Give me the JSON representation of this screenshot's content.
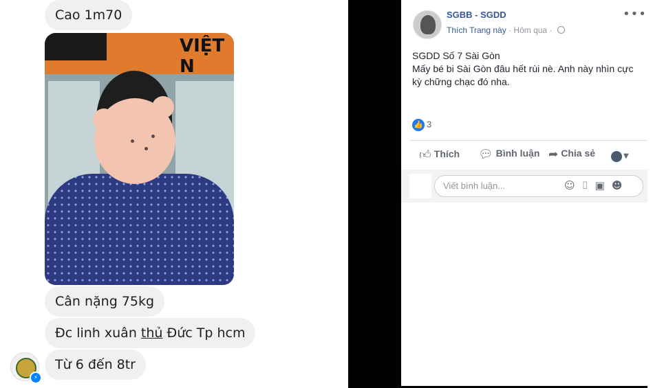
{
  "chat": {
    "messages": [
      {
        "text": "Cao 1m70"
      },
      {
        "text": "Cân nặng 75kg"
      },
      {
        "text_before": "Đc linh xuân ",
        "text_underlined": "thủ",
        "text_after": " Đức Tp hcm"
      },
      {
        "text": "Từ 6 đến 8tr"
      }
    ],
    "photo_banner_text": "VIỆT N"
  },
  "post": {
    "page_name": "SGBB - SGDD",
    "like_page_label": "Thích Trang này",
    "time": "Hôm qua",
    "more_icon": "more-horizontal-icon",
    "text_line1": "SGDD Số 7 Sài Gòn",
    "text_line2": "Mấy bé bi Sài Gòn đâu hết rùi nè. Anh này nhìn cực kỳ chững chạc đó nha.",
    "reaction_count": "3",
    "actions": {
      "like": "Thích",
      "comment": "Bình luận",
      "share": "Chia sẻ"
    },
    "comment_placeholder": "Viết bình luận..."
  },
  "colors": {
    "link_blue": "#365899",
    "like_blue": "#2078f4",
    "bubble_gray": "#f1f0f0",
    "messenger_blue": "#0084ff"
  }
}
